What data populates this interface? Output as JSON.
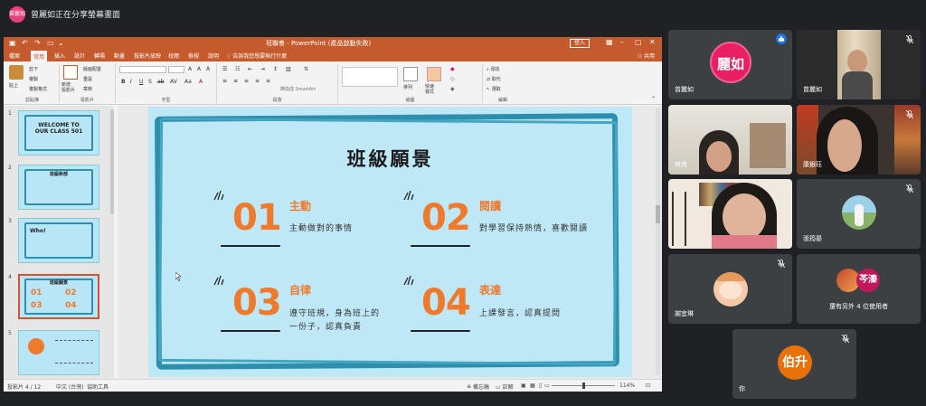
{
  "presenting_bar": {
    "badge": "曾麗如",
    "message": "曾麗如正在分享螢幕畫面"
  },
  "ppt": {
    "document_title": "班聯會 - PowerPoint (產品啟動失敗)",
    "signin": "登入",
    "tabs": [
      "檔案",
      "常用",
      "插入",
      "設計",
      "轉場",
      "動畫",
      "投影片放映",
      "校閱",
      "檢視",
      "說明"
    ],
    "active_tab_index": 1,
    "search": "告訴我您想要執行什麼",
    "share": "共用",
    "ribbon": {
      "paste": "貼上",
      "cut": "剪下",
      "copy": "複製",
      "format_painter": "複製格式",
      "clipboard": "剪貼簿",
      "new_slide": "新增\n投影片",
      "layout": "版面配置",
      "reset": "重設",
      "section": "章節",
      "slides": "投影片",
      "font": "字型",
      "paragraph": "段落",
      "convert_smartart": "轉換成 SmartArt",
      "drawing": "繪圖",
      "arrange": "排列",
      "quick_styles": "快速\n樣式",
      "find": "尋找",
      "replace": "取代",
      "select": "選取",
      "editing": "編輯"
    },
    "thumbnails": [
      {
        "num": "1",
        "title": "WELCOME TO OUR CLASS 501"
      },
      {
        "num": "2",
        "title": "班級幹部"
      },
      {
        "num": "3",
        "title": "Who!"
      },
      {
        "num": "4",
        "title": "班級願景"
      },
      {
        "num": "5",
        "title": ""
      }
    ],
    "slide": {
      "title": "班級願景",
      "items": [
        {
          "num": "01",
          "heading": "主動",
          "desc": "主動做對的事情"
        },
        {
          "num": "02",
          "heading": "閱讀",
          "desc": "對學習保持熱情，喜歡閱讀"
        },
        {
          "num": "03",
          "heading": "自律",
          "desc": "遵守班規，身為班上的一份子，認真負責"
        },
        {
          "num": "04",
          "heading": "表達",
          "desc": "上課發言，認真提問"
        }
      ]
    },
    "status": {
      "slide_count": "投影片 4 / 12",
      "language": "中文 (台灣)",
      "accessibility": "協助工具",
      "notes": "備忘稿",
      "comments": "註解",
      "zoom": "114%"
    }
  },
  "participants": [
    {
      "name": "曾麗如",
      "avatar": "麗如",
      "color": "#e91e63",
      "speaking": true
    },
    {
      "name": "曾麗如",
      "video": true
    },
    {
      "name": "林育",
      "video": true
    },
    {
      "name": "康銀珏",
      "video": true
    },
    {
      "name": "",
      "video": true
    },
    {
      "name": "張筠晏",
      "video": true
    },
    {
      "name": "謝宜琳",
      "video": false
    },
    {
      "name": "還有另外 4 位使用者",
      "avatar": "芩溱",
      "color": "#c2185b"
    },
    {
      "name": "你",
      "avatar": "伯升",
      "color": "#e8710a"
    }
  ]
}
